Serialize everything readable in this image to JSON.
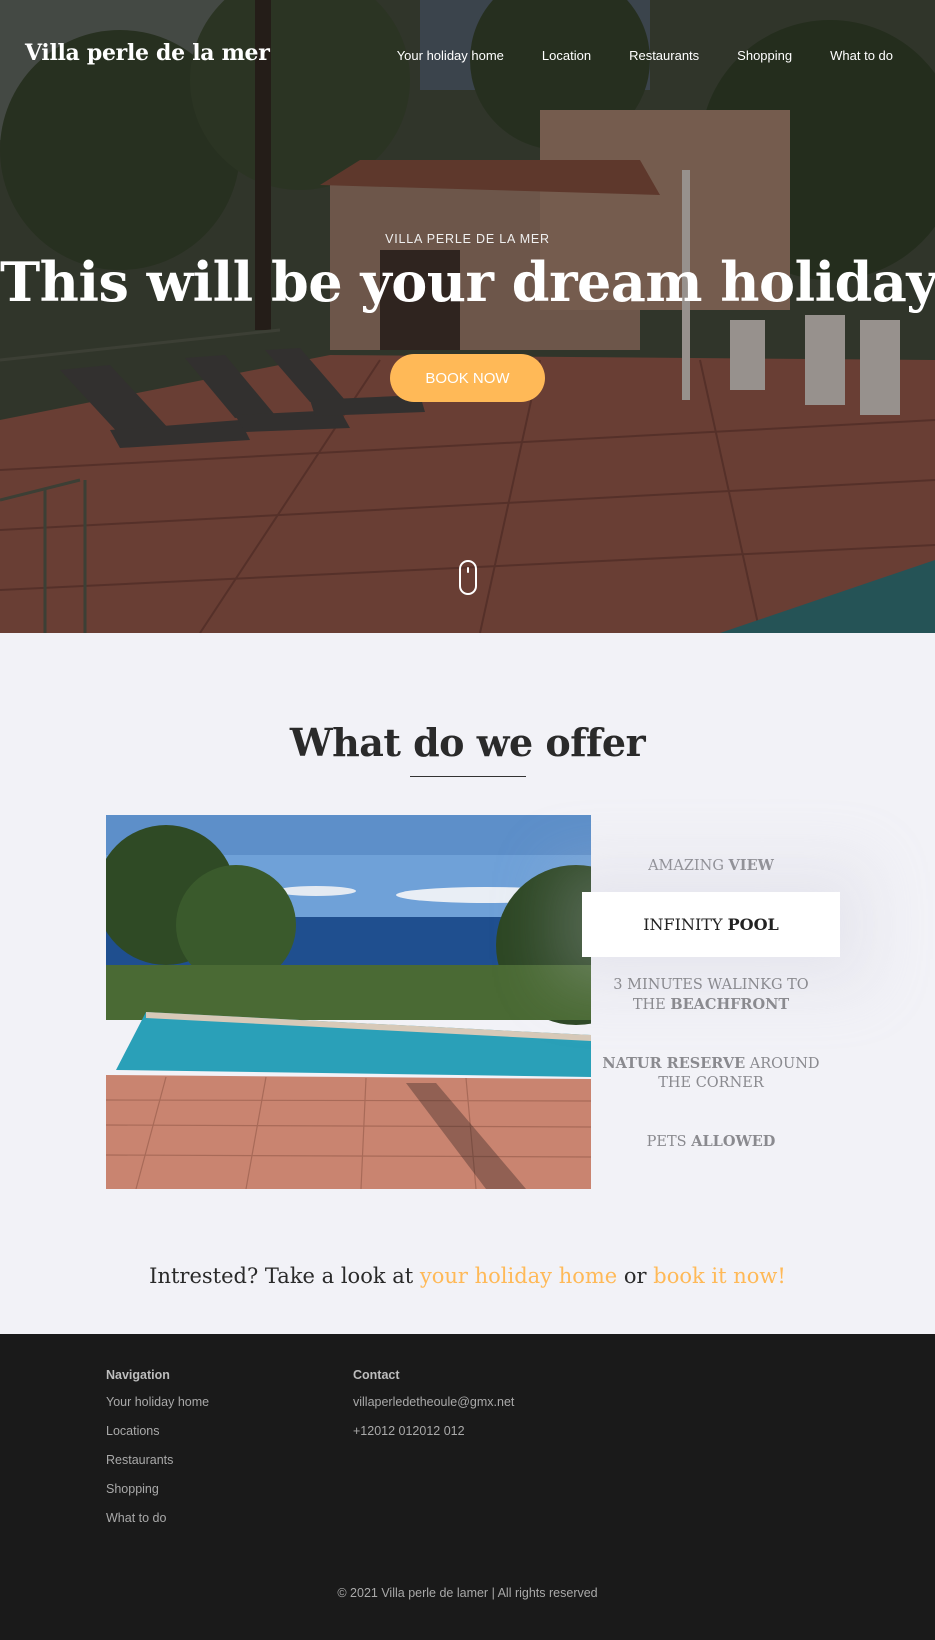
{
  "header": {
    "logo": "Villa perle de la mer",
    "nav": [
      "Your holiday home",
      "Location",
      "Restaurants",
      "Shopping",
      "What to do"
    ]
  },
  "hero": {
    "kicker": "VILLA PERLE DE LA MER",
    "headline": "This will be your dream holiday",
    "book_label": "BOOK NOW",
    "scroll_icon": "mouse-icon"
  },
  "offer": {
    "title": "What do we offer",
    "features": [
      {
        "before": "AMAZING ",
        "bold": "VIEW",
        "after": ""
      },
      {
        "before": "INFINITY ",
        "bold": "POOL",
        "after": ""
      },
      {
        "before": "3 MINUTES WALINKG TO THE ",
        "bold": "BEACHFRONT",
        "after": ""
      },
      {
        "before": "",
        "bold": "NATUR RESERVE",
        "after": " AROUND THE CORNER"
      },
      {
        "before": "PETS ",
        "bold": "ALLOWED",
        "after": ""
      }
    ],
    "active_index": 1
  },
  "cta": {
    "prefix": "Intrested? Take a look at ",
    "link1": "your holiday home",
    "middle": " or ",
    "link2": "book it now!"
  },
  "footer": {
    "nav_title": "Navigation",
    "nav_items": [
      "Your holiday home",
      "Locations",
      "Restaurants",
      "Shopping",
      "What to do"
    ],
    "contact_title": "Contact",
    "email": "villaperledetheoule@gmx.net",
    "phone": "+12012 012012 012",
    "copyright": "© 2021 Villa perle de lamer | All rights reserved"
  },
  "colors": {
    "accent": "#ffb957",
    "footer_bg": "#1a1a1a",
    "page_bg": "#f2f2f7"
  }
}
